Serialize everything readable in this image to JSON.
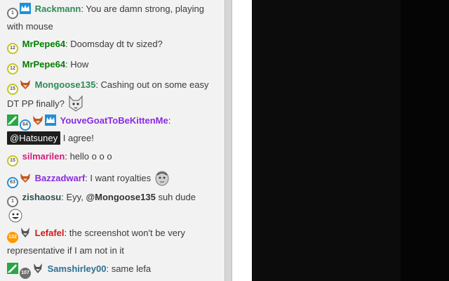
{
  "colors": {
    "chat_bg": "#f2f2f2",
    "player_bg": "#0c0c0c",
    "twitch_blue": "#1e90d8",
    "bits_green": "#28a745"
  },
  "messages": [
    {
      "sub_months": "1",
      "badge_color": "#7a7a7a",
      "extra_badges": [
        "crown-icon"
      ],
      "user": "Rackmann",
      "user_color": "#2e8b57",
      "text_1": "You are damn strong, playing",
      "text_2": "with mouse"
    },
    {
      "sub_months": "12",
      "badge_color": "#c6c618",
      "user": "MrPepe64",
      "user_color": "#008000",
      "text": "Doomsday dt tv sized?"
    },
    {
      "sub_months": "12",
      "badge_color": "#c6c618",
      "user": "MrPepe64",
      "user_color": "#008000",
      "text": "How"
    },
    {
      "sub_months": "15",
      "badge_color": "#c6c618",
      "extra_badges": [
        "fox-icon"
      ],
      "user": "Mongoose135",
      "user_color": "#2e8b57",
      "text_1": "Cashing out on some easy",
      "text_2": "DT PP finally?",
      "emote": "cat-face-emote"
    },
    {
      "sub_months": "64",
      "badge_color": "#1e90d8",
      "extra_badges": [
        "sword-icon",
        "fox-icon",
        "crown-icon"
      ],
      "user": "YouveGoatToBeKittenMe",
      "user_color": "#8a2be2",
      "mention": "@Hatsuney",
      "text": "I agree!"
    },
    {
      "sub_months": "15",
      "badge_color": "#c6c618",
      "user": "silmarilen",
      "user_color": "#d0217a",
      "text": "hello o o o"
    },
    {
      "sub_months": "63",
      "badge_color": "#1e90d8",
      "extra_badges": [
        "fox-icon"
      ],
      "user": "Bazzadwarf",
      "user_color": "#8a2be2",
      "text": "I want royalties",
      "emote": "kappa-face-emote"
    },
    {
      "sub_months": "1",
      "badge_color": "#7a7a7a",
      "user": "zishaosu",
      "user_color": "#2f4f4f",
      "text_1": "Eyy,",
      "mention": "@Mongoose135",
      "text_2": "suh dude",
      "emote": "smiley-face-emote"
    },
    {
      "sub_months": "132",
      "badge_color": "#ff9800",
      "extra_badges": [
        "wolf-icon"
      ],
      "user": "Lefafel",
      "user_color": "#d11818",
      "text_1": "the screenshot won't be very",
      "text_2": "representative if I am not in it"
    },
    {
      "sub_months": "107",
      "badge_color": "#6e6e6e",
      "extra_badges": [
        "sword-icon",
        "wolf-icon"
      ],
      "user": "Samshirley00",
      "user_color": "#2f6f8f",
      "text": "same lefa"
    }
  ]
}
